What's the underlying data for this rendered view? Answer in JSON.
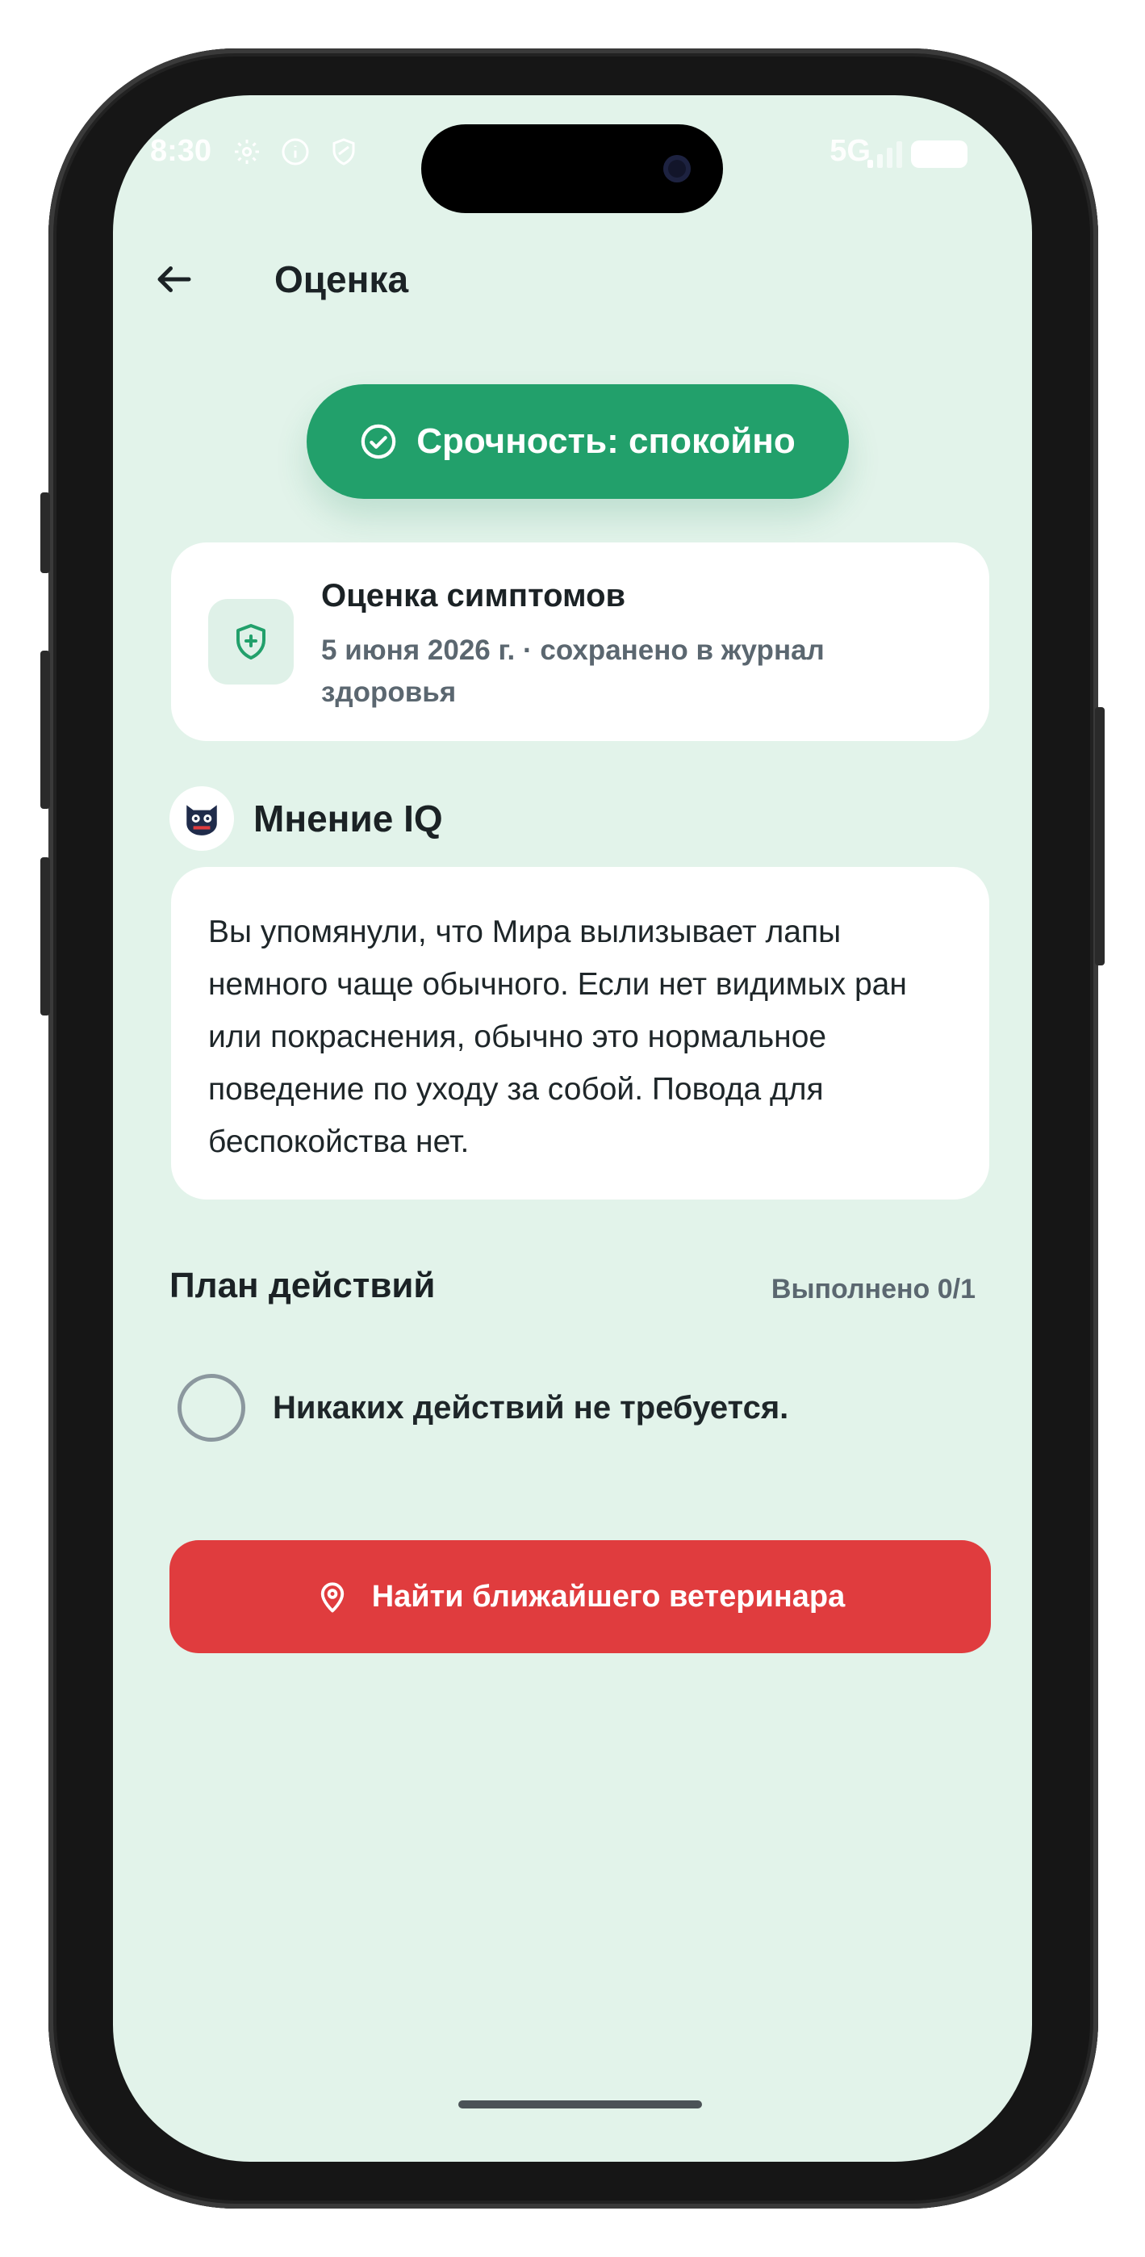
{
  "status_bar": {
    "time": "8:30",
    "network": "5G",
    "icons": [
      "gear-icon",
      "info-icon",
      "shield-icon",
      "signal-icon",
      "battery-icon"
    ]
  },
  "header": {
    "title": "Оценка",
    "back_icon": "arrow-left-icon"
  },
  "urgency": {
    "label": "Срочность: спокойно",
    "icon": "check-circle-icon",
    "color": "#22a06b"
  },
  "assessment": {
    "title": "Оценка симптомов",
    "subtitle": "5 июня 2026 г. · сохранено в журнал здоровья",
    "icon": "shield-plus-icon"
  },
  "opinion": {
    "title": "Мнение IQ",
    "avatar_icon": "cat-avatar-icon",
    "text": "Вы упомянули, что Мира вылизывает лапы немного чаще обычного. Если нет видимых ран или покраснения, обычно это нормальное поведение по уходу за собой. Повода для беспокойства нет."
  },
  "plan": {
    "title": "План действий",
    "progress": "Выполнено 0/1",
    "items": [
      {
        "label": "Никаких действий не требуется.",
        "checked": false
      }
    ]
  },
  "vet_button": {
    "label": "Найти ближайшего ветеринара",
    "icon": "map-pin-icon",
    "color": "#e03c3e"
  },
  "colors": {
    "background": "#e2f3ea",
    "accent": "#22a06b",
    "danger": "#e03c3e"
  }
}
